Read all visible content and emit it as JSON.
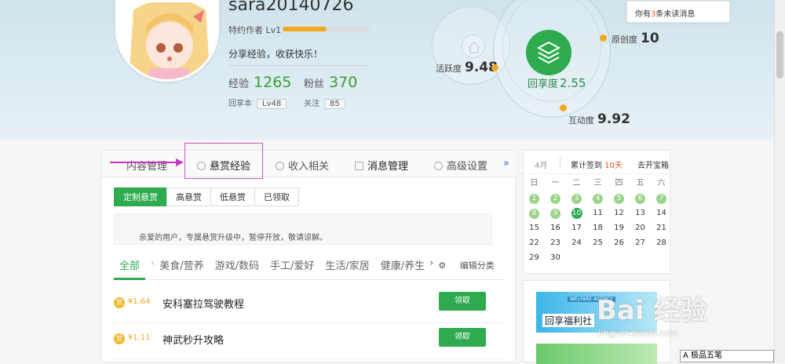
{
  "profile": {
    "username": "sara20140726",
    "role": "特约作者 Lv1",
    "level_progress": 0.5,
    "motto": "分享经验，收获快乐！",
    "experience_label": "经验",
    "experience_value": "1265",
    "fans_label": "粉丝",
    "fans_value": "370",
    "huixiang_label": "回享本",
    "huixiang_level": "Lv48",
    "follow_label": "关注",
    "follow_value": "85"
  },
  "metrics": {
    "activity_label": "活跃度",
    "activity_value": "9.48",
    "originality_label": "原创度",
    "originality_value": "10",
    "share_label": "回享度",
    "share_value": "2.55",
    "interaction_label": "互动度",
    "interaction_value": "9.92"
  },
  "notification": {
    "prefix": "你有",
    "count": "3",
    "suffix": "条未读消息"
  },
  "tabs": {
    "content_manage": "内容管理",
    "reward_experience": "悬赏经验",
    "income": "收入相关",
    "message_manage": "消息管理",
    "advanced_settings": "高级设置",
    "more": "»"
  },
  "subtabs": [
    "定制悬赏",
    "高悬赏",
    "低悬赏",
    "已领取"
  ],
  "notice_text": "亲爱的用户，专属悬赏升级中，暂停开放，敬请谅解。",
  "categories": [
    "全部",
    "‹",
    "美食/营养",
    "游戏/数码",
    "手工/爱好",
    "生活/家居",
    "健康/养生",
    "›"
  ],
  "edit_category": "编辑分类",
  "rewards": [
    {
      "coin": "赏",
      "price": "¥1.64",
      "title": "安科塞拉驾驶教程",
      "action": "领取"
    },
    {
      "coin": "赏",
      "price": "¥1.11",
      "title": "神武秒升攻略",
      "action": "领取"
    }
  ],
  "calendar": {
    "month": "4月",
    "signed_prefix": "累计签到",
    "signed_days": "10天",
    "open_treasure": "去开宝箱",
    "weekdays": [
      "日",
      "一",
      "二",
      "三",
      "四",
      "五",
      "六"
    ],
    "checked_days": [
      1,
      2,
      3,
      4,
      5,
      6,
      7,
      8,
      9
    ],
    "today": 10,
    "first_weekday": 0,
    "days_in_month": 30
  },
  "promo": {
    "banner_text": "回享福利社",
    "banner_tag": "WELFARE AGENCY"
  },
  "watermark": {
    "main": "Bai 经验",
    "sub": "jingyan.baidu.com"
  },
  "ime": "A 极品五笔"
}
